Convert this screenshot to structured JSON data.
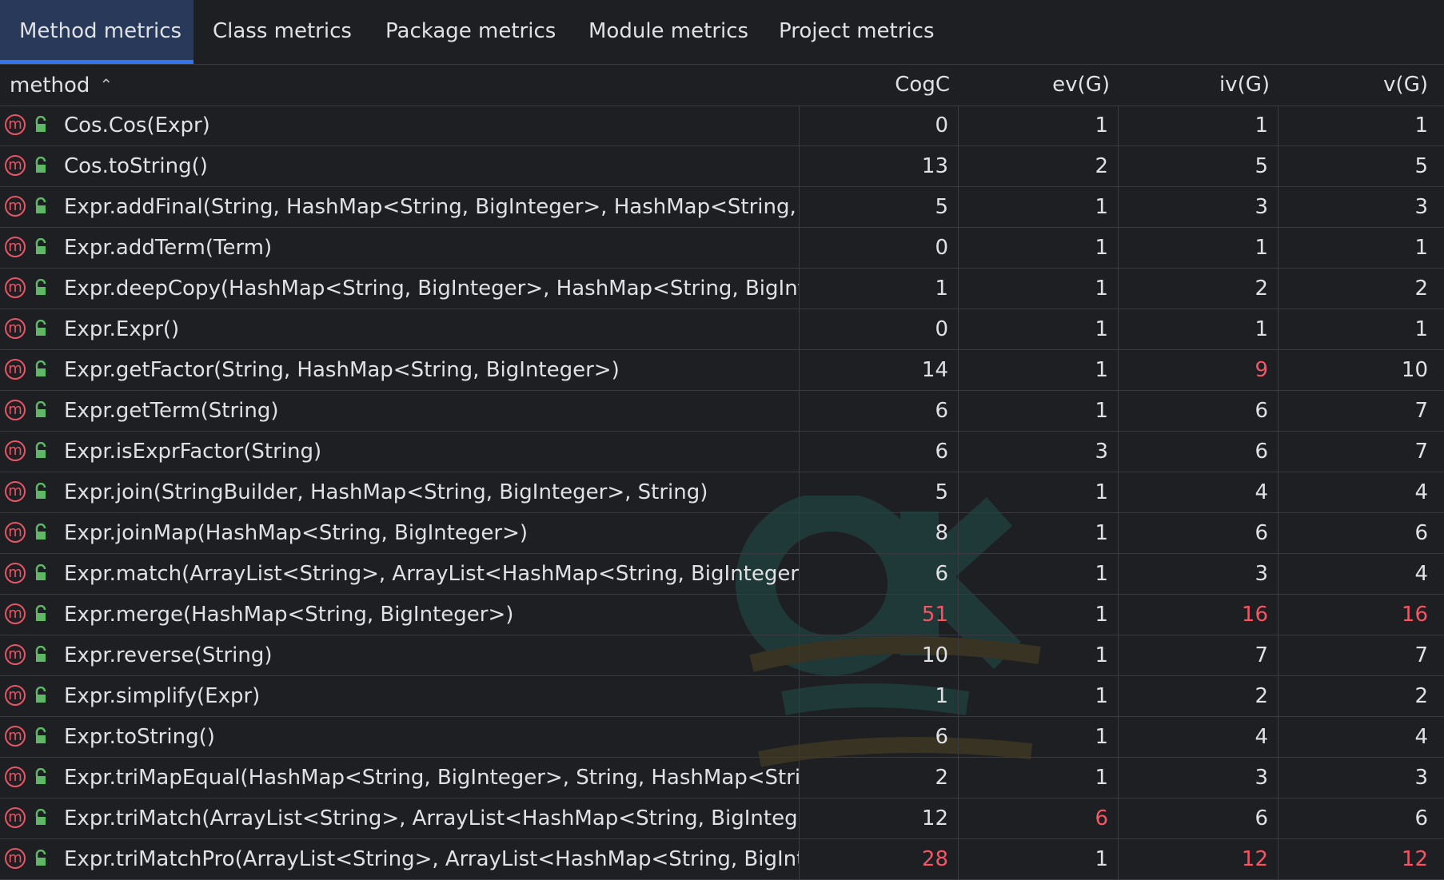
{
  "tabs": [
    {
      "label": "Method metrics",
      "selected": true
    },
    {
      "label": "Class metrics",
      "selected": false
    },
    {
      "label": "Package metrics",
      "selected": false
    },
    {
      "label": "Module metrics",
      "selected": false
    },
    {
      "label": "Project metrics",
      "selected": false
    }
  ],
  "columns": {
    "method": "method",
    "cogc": "CogC",
    "ev": "ev(G)",
    "iv": "iv(G)",
    "v": "v(G)"
  },
  "sort_icon": "chevron-up-icon",
  "colors": {
    "accent": "#3574f0",
    "warning": "#f75464",
    "method_icon": "#e55766",
    "public_icon": "#5fb865"
  },
  "rows": [
    {
      "method": "Cos.Cos(Expr)",
      "cogc": "0",
      "ev": "1",
      "iv": "1",
      "v": "1"
    },
    {
      "method": "Cos.toString()",
      "cogc": "13",
      "ev": "2",
      "iv": "5",
      "v": "5"
    },
    {
      "method": "Expr.addFinal(String, HashMap<String, BigInteger>, HashMap<String, BigIr",
      "cogc": "5",
      "ev": "1",
      "iv": "3",
      "v": "3"
    },
    {
      "method": "Expr.addTerm(Term)",
      "cogc": "0",
      "ev": "1",
      "iv": "1",
      "v": "1"
    },
    {
      "method": "Expr.deepCopy(HashMap<String, BigInteger>, HashMap<String, BigIntege",
      "cogc": "1",
      "ev": "1",
      "iv": "2",
      "v": "2"
    },
    {
      "method": "Expr.Expr()",
      "cogc": "0",
      "ev": "1",
      "iv": "1",
      "v": "1"
    },
    {
      "method": "Expr.getFactor(String, HashMap<String, BigInteger>)",
      "cogc": "14",
      "ev": "1",
      "iv": "9",
      "v": "10",
      "warn": [
        "iv"
      ]
    },
    {
      "method": "Expr.getTerm(String)",
      "cogc": "6",
      "ev": "1",
      "iv": "6",
      "v": "7"
    },
    {
      "method": "Expr.isExprFactor(String)",
      "cogc": "6",
      "ev": "3",
      "iv": "6",
      "v": "7"
    },
    {
      "method": "Expr.join(StringBuilder, HashMap<String, BigInteger>, String)",
      "cogc": "5",
      "ev": "1",
      "iv": "4",
      "v": "4"
    },
    {
      "method": "Expr.joinMap(HashMap<String, BigInteger>)",
      "cogc": "8",
      "ev": "1",
      "iv": "6",
      "v": "6"
    },
    {
      "method": "Expr.match(ArrayList<String>, ArrayList<HashMap<String, BigInteger>>, H",
      "cogc": "6",
      "ev": "1",
      "iv": "3",
      "v": "4"
    },
    {
      "method": "Expr.merge(HashMap<String, BigInteger>)",
      "cogc": "51",
      "ev": "1",
      "iv": "16",
      "v": "16",
      "warn": [
        "cogc",
        "iv",
        "v"
      ]
    },
    {
      "method": "Expr.reverse(String)",
      "cogc": "10",
      "ev": "1",
      "iv": "7",
      "v": "7"
    },
    {
      "method": "Expr.simplify(Expr)",
      "cogc": "1",
      "ev": "1",
      "iv": "2",
      "v": "2"
    },
    {
      "method": "Expr.toString()",
      "cogc": "6",
      "ev": "1",
      "iv": "4",
      "v": "4"
    },
    {
      "method": "Expr.triMapEqual(HashMap<String, BigInteger>, String, HashMap<String, B",
      "cogc": "2",
      "ev": "1",
      "iv": "3",
      "v": "3"
    },
    {
      "method": "Expr.triMatch(ArrayList<String>, ArrayList<HashMap<String, BigInteger>>,",
      "cogc": "12",
      "ev": "6",
      "iv": "6",
      "v": "6",
      "warn": [
        "ev"
      ]
    },
    {
      "method": "Expr.triMatchPro(ArrayList<String>, ArrayList<HashMap<String, BigIntege",
      "cogc": "28",
      "ev": "1",
      "iv": "12",
      "v": "12",
      "warn": [
        "cogc",
        "iv",
        "v"
      ]
    }
  ]
}
